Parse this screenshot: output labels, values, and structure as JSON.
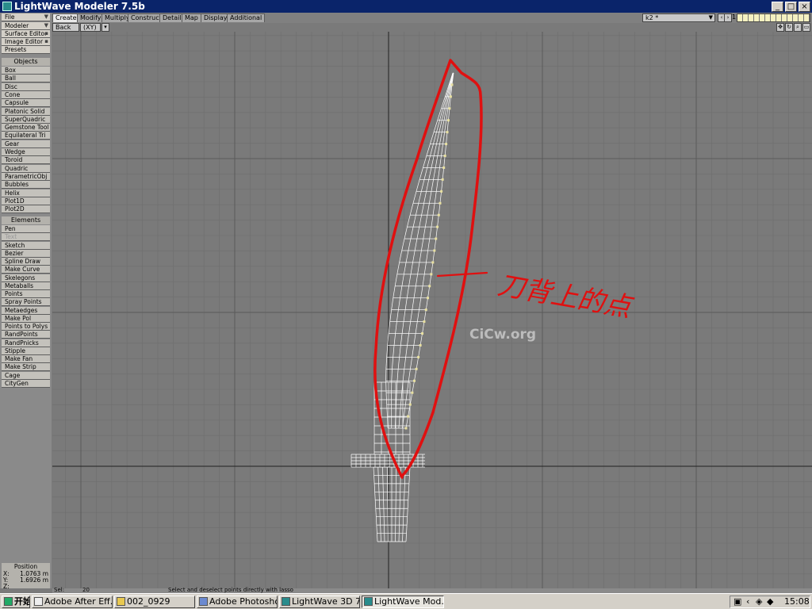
{
  "window": {
    "title": "LightWave Modeler 7.5b",
    "min": "_",
    "max": "□",
    "close": "×"
  },
  "tabs": [
    "Create",
    "Modify",
    "Multiply",
    "Construct",
    "Detail",
    "Map",
    "Display",
    "Additional"
  ],
  "top_right": {
    "layer": "k2 *",
    "layer_num": "1"
  },
  "view": {
    "name": "Back",
    "axis": "(XY)"
  },
  "sidebar": {
    "file": "File",
    "modeler": "Modeler",
    "surface_editor": "Surface Editor",
    "image_editor": "Image Editor",
    "presets": "Presets",
    "objects_header": "Objects",
    "objects": [
      "Box",
      "Ball",
      "Disc",
      "Cone",
      "Capsule",
      "Platonic Solid",
      "SuperQuadric",
      "Gemstone Tool",
      "Equilateral Tri",
      "Gear",
      "Wedge",
      "Toroid",
      "Quadric",
      "ParametricObj",
      "Bubbles",
      "Helix",
      "Plot1D",
      "Plot2D"
    ],
    "elements_header": "Elements",
    "elements": [
      "Pen",
      "Text",
      "Sketch",
      "Bezier",
      "Spline Draw",
      "Make Curve",
      "Skelegons",
      "Metaballs",
      "Points",
      "Spray Points",
      "Metaedges",
      "Make Pol",
      "Points to Polys",
      "RandPoints",
      "RandPnicks",
      "Stipple",
      "Make Fan",
      "Make Strip",
      "Cage",
      "CityGen"
    ]
  },
  "position": {
    "label": "Position",
    "x_label": "X:",
    "x": "1.0763 m",
    "y_label": "Y:",
    "y": "1.6926 m",
    "z_label": "Z:"
  },
  "statusbar": {
    "left": "Sel:",
    "left_val": "20",
    "message": "Select and deselect points directly with lasso"
  },
  "annotation": {
    "text": "刀背上的点",
    "color": "#e01010"
  },
  "watermark": "CiCw.org",
  "taskbar": {
    "start": "开始",
    "items": [
      "Adobe After Eff...",
      "002_0929",
      "Adobe Photoshop",
      "LightWave 3D 7...",
      "LightWave Mod..."
    ],
    "clock": "15:08"
  },
  "colors": {
    "wire": "#ffffff",
    "point": "#e8e0a0",
    "grid_minor": "#6e6e6e",
    "grid_major": "#5a5a5a"
  }
}
